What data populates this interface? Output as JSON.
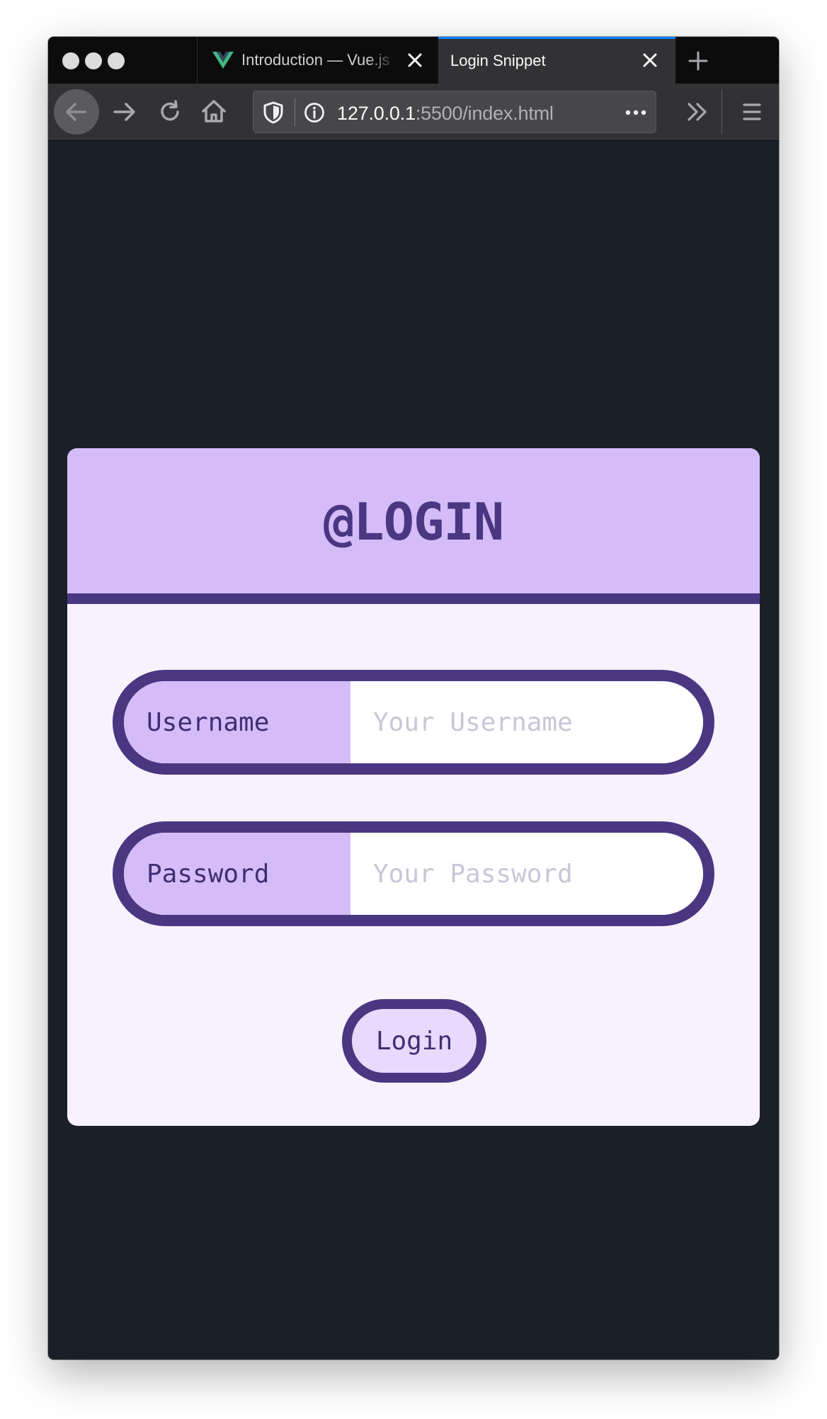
{
  "browser": {
    "tabs": [
      {
        "title": "Introduction — Vue.js",
        "active": false,
        "favicon": "vue-logo-icon"
      },
      {
        "title": "Login Snippet",
        "active": true,
        "favicon": ""
      }
    ],
    "new_tab_icon": "plus-icon",
    "url": {
      "host": "127.0.0.1",
      "rest": ":5500/index.html"
    }
  },
  "login_card": {
    "title": "@LOGIN",
    "username": {
      "label": "Username",
      "placeholder": "Your Username",
      "value": ""
    },
    "password": {
      "label": "Password",
      "placeholder": "Your Password",
      "value": ""
    },
    "submit_label": "Login"
  },
  "colors": {
    "page_background": "#1b1f2a",
    "accent_dark": "#4a3782",
    "accent_light": "#d5bcf8",
    "card_body": "#f8f2fe",
    "button_fill": "#e8d9fd"
  }
}
